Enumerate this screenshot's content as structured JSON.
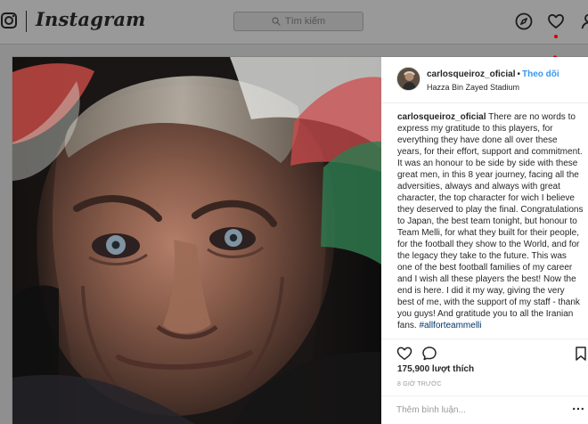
{
  "top_bar": {
    "brand": "Instagram",
    "search_placeholder": "Tìm kiếm",
    "icons": [
      "camera-icon",
      "search-icon",
      "compass-icon",
      "heart-icon",
      "user-icon"
    ],
    "accent": "#d90000"
  },
  "post": {
    "photo": "man-face-close-up",
    "username": "carlosqueiroz_oficial",
    "follow_separator": "•",
    "follow": "Theo dõi",
    "location": "Hazza Bin Zayed Stadium",
    "caption_user": "carlosqueiroz_oficial",
    "caption_text": "There are no words to express my gratitude to this players, for everything they have done all over these years, for their effort, support and commitment. It was an honour to be side by side with these great men, in this 8 year journey, facing all the adversities, always and always with great character, the top character for wich I believe they deserved to play the final. Congratulations to Japan, the best team tonight, but honour to Team Melli, for what they built for their people, for the football they show to the World, and for the legacy they take to the future. This was one of the best football families of my career and I wish all these players the best! Now the end is here. I did it my way, giving the very best of me, with the support of my staff - thank you guys! And gratitude you to all the Iranian fans.",
    "hashtag": "#allforteammelli",
    "likes": "175,900 lượt thích",
    "time_ago": "8 GIỜ TRƯỚC",
    "comment_placeholder": "Thêm bình luận...",
    "actions": [
      "heart-icon",
      "comment-icon",
      "bookmark-icon",
      "more-icon"
    ],
    "link_color": "#3897f0",
    "hashtag_color": "#003569"
  }
}
